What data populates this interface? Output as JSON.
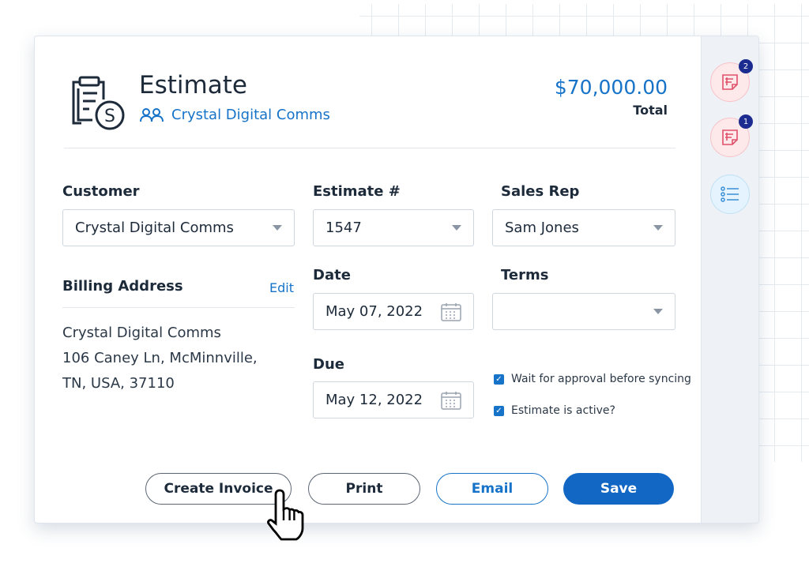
{
  "header": {
    "title": "Estimate",
    "customer_link": "Crystal Digital Comms",
    "total_amount": "$70,000.00",
    "total_label": "Total"
  },
  "form": {
    "customer": {
      "label": "Customer",
      "value": "Crystal Digital Comms"
    },
    "estimate_no": {
      "label": "Estimate #",
      "value": "1547"
    },
    "sales_rep": {
      "label": "Sales Rep",
      "value": "Sam Jones"
    },
    "billing": {
      "label": "Billing Address",
      "edit": "Edit",
      "lines": [
        "Crystal Digital Comms",
        "106 Caney Ln, McMinnville,",
        "TN, USA, 37110"
      ]
    },
    "date": {
      "label": "Date",
      "value": "May 07, 2022"
    },
    "terms": {
      "label": "Terms",
      "value": ""
    },
    "due": {
      "label": "Due",
      "value": "May 12, 2022"
    },
    "checkboxes": [
      {
        "label": "Wait for approval before syncing",
        "checked": true
      },
      {
        "label": "Estimate is active?",
        "checked": true
      }
    ]
  },
  "buttons": {
    "create_invoice": "Create Invoice",
    "print": "Print",
    "email": "Email",
    "save": "Save"
  },
  "side": {
    "badges": [
      "2",
      "1"
    ]
  },
  "colors": {
    "accent": "#1673c8",
    "badge": "#1c2b8f"
  }
}
